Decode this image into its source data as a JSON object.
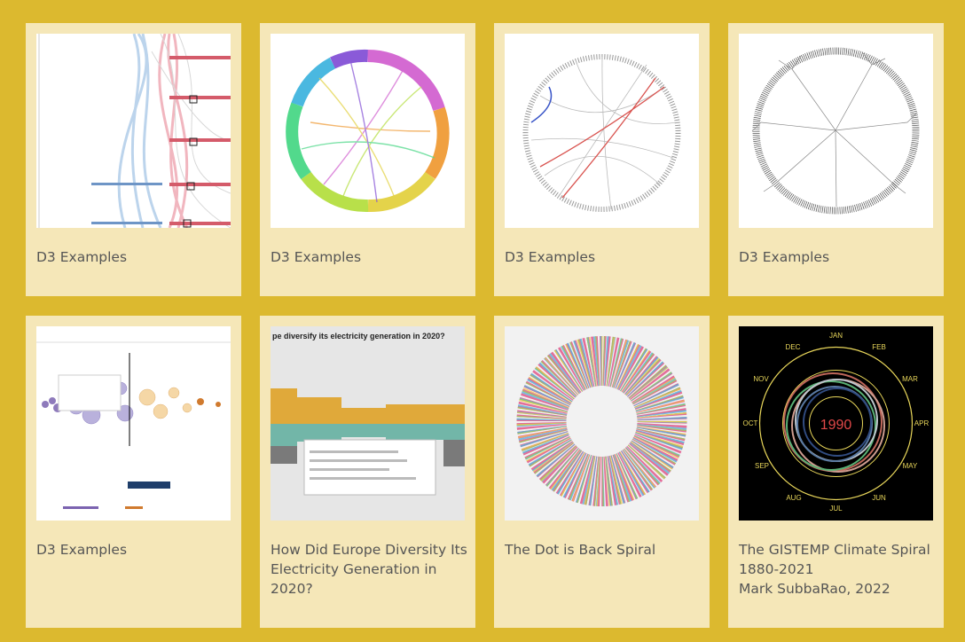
{
  "gallery": {
    "cards": [
      {
        "caption": "D3 Examples",
        "thumb": "storyline-diagram"
      },
      {
        "caption": "D3 Examples",
        "thumb": "chord-diagram"
      },
      {
        "caption": "D3 Examples",
        "thumb": "hierarchical-edge-bundling"
      },
      {
        "caption": "D3 Examples",
        "thumb": "radial-tree"
      },
      {
        "caption": "D3 Examples",
        "thumb": "beeswarm-market-cap"
      },
      {
        "caption": "How Did Europe Diversity Its Electricity Generation in 2020?",
        "thumb": "europe-electricity-chart",
        "thumb_text": {
          "headline": "pe diversify its electricity generation in 2020?"
        }
      },
      {
        "caption": "The Dot is Back Spiral",
        "thumb": "dot-spiral"
      },
      {
        "caption": "The GISTEMP Climate Spiral 1880-2021\nMark SubbaRao, 2022",
        "thumb": "climate-spiral",
        "thumb_text": {
          "year": "1990",
          "months": [
            "JAN",
            "FEB",
            "MAR",
            "APR",
            "MAY",
            "JUN",
            "JUL",
            "AUG",
            "SEP",
            "OCT",
            "NOV",
            "DEC"
          ]
        }
      }
    ]
  }
}
